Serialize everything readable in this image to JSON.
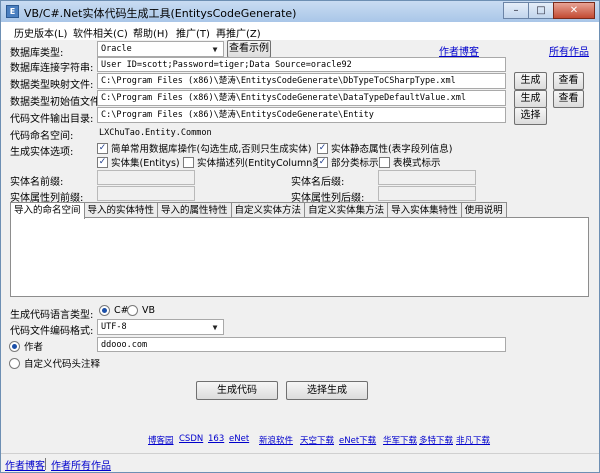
{
  "window": {
    "title": "VB/C#.Net实体代码生成工具(EntitysCodeGenerate)",
    "minimize": "–",
    "maximize": "□",
    "close": "✕",
    "icon": "app-icon"
  },
  "menu": [
    "历史版本(L)",
    "软件相关(C)",
    "帮助(H)",
    "推广(T)",
    "再推广(Z)"
  ],
  "db_type": {
    "label": "数据库类型:",
    "value": "Oracle",
    "view_example": "查看示例"
  },
  "links_top": {
    "author_blog": "作者博客",
    "all_works": "所有作品"
  },
  "conn_string": {
    "label": "数据库连接字符串:",
    "value": "User ID=scott;Password=tiger;Data Source=oracle92"
  },
  "type_map_file": {
    "label": "数据类型映射文件:",
    "value": "C:\\Program Files (x86)\\楚涛\\EntitysCodeGenerate\\DbTypeToCSharpType.xml",
    "generate": "生成",
    "view": "查看"
  },
  "type_default_file": {
    "label": "数据类型初始值文件:",
    "value": "C:\\Program Files (x86)\\楚涛\\EntitysCodeGenerate\\DataTypeDefaultValue.xml",
    "generate": "生成",
    "view": "查看"
  },
  "output_dir": {
    "label": "代码文件输出目录:",
    "value": "C:\\Program Files (x86)\\楚涛\\EntitysCodeGenerate\\Entity",
    "select": "选择"
  },
  "namespace": {
    "label": "代码命名空间:",
    "value": "LXChuTao.Entity.Common"
  },
  "entity_options": {
    "label": "生成实体选项:",
    "items": [
      {
        "label": "简单常用数据库操作(勾选生成,否则只生成实体)",
        "checked": true
      },
      {
        "label": "实体静态属性(表字段列信息)",
        "checked": true
      },
      {
        "label": "实体集(Entitys)",
        "checked": true
      },
      {
        "label": "实体描述列(EntityColumn类)",
        "checked": false
      },
      {
        "label": "部分类标示",
        "checked": true
      },
      {
        "label": "表模式标示",
        "checked": false
      }
    ]
  },
  "affixes": {
    "entity_prefix": "实体名前缀:",
    "entity_suffix": "实体名后缀:",
    "attr_prefix": "实体属性列前缀:",
    "attr_suffix": "实体属性列后缀:"
  },
  "tabs": [
    "导入的命名空间",
    "导入的实体特性",
    "导入的属性特性",
    "自定义实体方法",
    "自定义实体集方法",
    "导入实体集特性",
    "使用说明"
  ],
  "language": {
    "label": "生成代码语言类型:",
    "options": [
      "C#",
      "VB"
    ],
    "selected": "C#"
  },
  "encoding": {
    "label": "代码文件编码格式:",
    "value": "UTF-8"
  },
  "author": {
    "label": "作者",
    "value": "ddooo.com",
    "selected": true
  },
  "custom_header": {
    "label": "自定义代码头注释"
  },
  "actions": {
    "generate": "生成代码",
    "select_generate": "选择生成"
  },
  "footer_links": [
    "博客园",
    "CSDN",
    "163",
    "eNet",
    "新浪软件",
    "天空下载",
    "eNet下载",
    "华军下载",
    "多特下载",
    "非凡下载"
  ],
  "statusbar": {
    "author_blog": "作者博客",
    "author_works": "作者所有作品"
  }
}
